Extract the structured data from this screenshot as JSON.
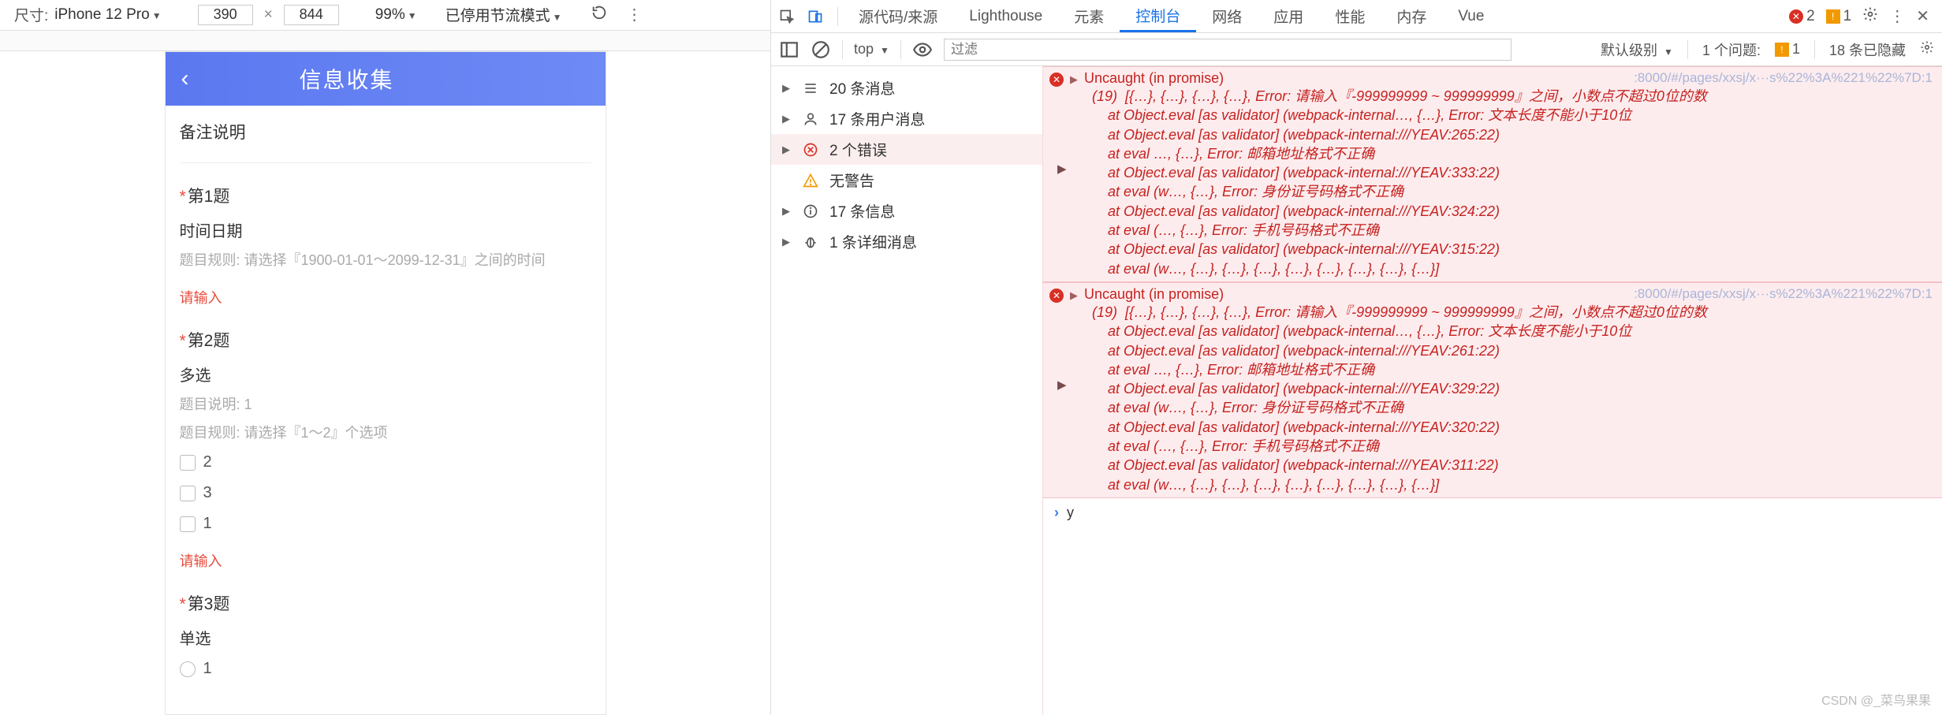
{
  "emulator_toolbar": {
    "size_label": "尺寸:",
    "device": "iPhone 12 Pro",
    "w": "390",
    "h": "844",
    "zoom": "99%",
    "throttle": "已停用节流模式"
  },
  "phone": {
    "title": "信息收集",
    "remark": "备注说明",
    "questions": [
      {
        "title": "第1题",
        "sub": "时间日期",
        "desc_rule": "题目规则:  请选择『1900-01-01～2099-12-31』之间的时间",
        "err": "请输入"
      },
      {
        "title": "第2题",
        "sub": "多选",
        "desc_note": "题目说明:  1",
        "desc_rule": "题目规则:  请选择『1～2』个选项",
        "options": [
          "2",
          "3",
          "1"
        ],
        "err": "请输入"
      },
      {
        "title": "第3题",
        "sub": "单选",
        "options": [
          "1"
        ]
      }
    ]
  },
  "devtools": {
    "tabs": [
      "源代码/来源",
      "Lighthouse",
      "元素",
      "控制台",
      "网络",
      "应用",
      "性能",
      "内存",
      "Vue"
    ],
    "active_tab": "控制台",
    "err_count": "2",
    "warn_count": "1",
    "subbar": {
      "ctx": "top",
      "filter_placeholder": "过滤",
      "level": "默认级别",
      "issues_label": "1 个问题:",
      "issues_count": "1",
      "hidden": "18 条已隐藏"
    },
    "sidebar": [
      {
        "icon": "list",
        "label": "20 条消息"
      },
      {
        "icon": "user",
        "label": "17 条用户消息"
      },
      {
        "icon": "error",
        "label": "2 个错误",
        "selected": true
      },
      {
        "icon": "warn",
        "label": "无警告",
        "leaf": true
      },
      {
        "icon": "info",
        "label": "17 条信息"
      },
      {
        "icon": "bug",
        "label": "1 条详细消息"
      }
    ],
    "errors": [
      {
        "title": "Uncaught (in promise)",
        "src": ":8000/#/pages/xxsj/x···s%22%3A%221%22%7D:1",
        "stack": "(19)  [{…}, {…}, {…}, {…}, Error: 请输入『-999999999 ~ 999999999』之间，小数点不超过0位的数\n    at Object.eval [as validator] (webpack-internal…, {…}, Error: 文本长度不能小于10位\n    at Object.eval [as validator] (webpack-internal:///YEAV:265:22)\n    at eval …, {…}, Error: 邮箱地址格式不正确\n    at Object.eval [as validator] (webpack-internal:///YEAV:333:22)\n    at eval (w…, {…}, Error: 身份证号码格式不正确\n    at Object.eval [as validator] (webpack-internal:///YEAV:324:22)\n    at eval (…, {…}, Error: 手机号码格式不正确\n    at Object.eval [as validator] (webpack-internal:///YEAV:315:22)\n    at eval (w…, {…}, {…}, {…}, {…}, {…}, {…}, {…}, {…}]"
      },
      {
        "title": "Uncaught (in promise)",
        "src": ":8000/#/pages/xxsj/x···s%22%3A%221%22%7D:1",
        "stack": "(19)  [{…}, {…}, {…}, {…}, Error: 请输入『-999999999 ~ 999999999』之间，小数点不超过0位的数\n    at Object.eval [as validator] (webpack-internal…, {…}, Error: 文本长度不能小于10位\n    at Object.eval [as validator] (webpack-internal:///YEAV:261:22)\n    at eval …, {…}, Error: 邮箱地址格式不正确\n    at Object.eval [as validator] (webpack-internal:///YEAV:329:22)\n    at eval (w…, {…}, Error: 身份证号码格式不正确\n    at Object.eval [as validator] (webpack-internal:///YEAV:320:22)\n    at eval (…, {…}, Error: 手机号码格式不正确\n    at Object.eval [as validator] (webpack-internal:///YEAV:311:22)\n    at eval (w…, {…}, {…}, {…}, {…}, {…}, {…}, {…}, {…}]"
      }
    ],
    "prompt_val": "y"
  },
  "watermark": "CSDN @_菜鸟果果"
}
